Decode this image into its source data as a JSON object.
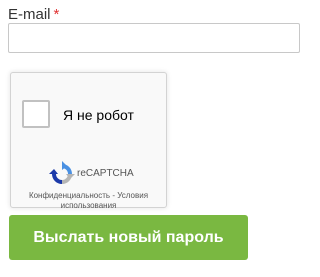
{
  "form": {
    "email_label": "E-mail",
    "required_marker": "*",
    "email_value": "",
    "submit_label": "Выслать новый пароль"
  },
  "recaptcha": {
    "checkbox_label": "Я не робот",
    "brand": "reCAPTCHA",
    "privacy_link": "Конфиденциальность",
    "separator": "-",
    "terms_link": "Условия использования"
  },
  "colors": {
    "required": "#e03131",
    "submit_bg": "#7ab841",
    "recaptcha_bg": "#f9f9f9",
    "recaptcha_blue": "#4a90e2",
    "recaptcha_gray": "#b5b5b5"
  },
  "icons": {
    "recaptcha_logo": "recaptcha-logo-icon"
  }
}
